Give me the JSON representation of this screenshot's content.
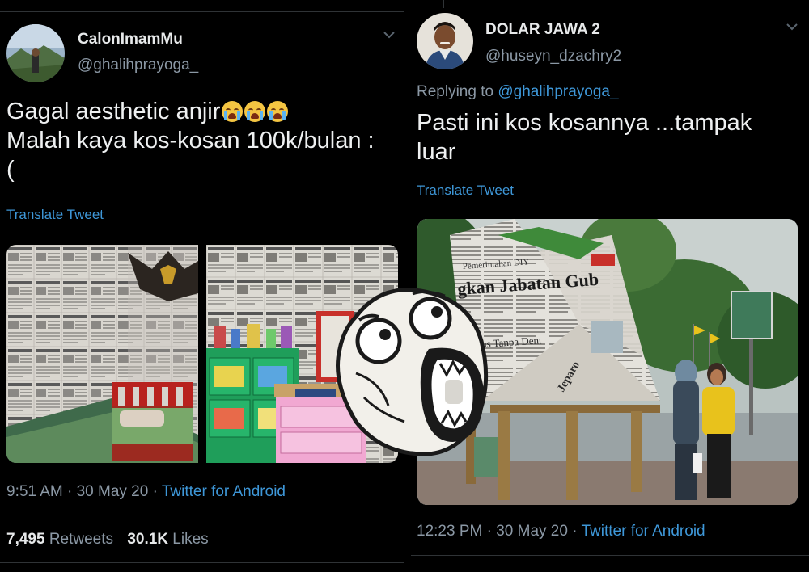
{
  "left_tweet": {
    "display_name": "CalonImamMu",
    "handle": "@ghalihprayoga_",
    "text_line1": "Gagal aesthetic anjir",
    "text_line2": "Malah kaya kos-kosan 100k/bulan :",
    "text_line3": "(",
    "emoji": [
      "loudly-crying-face",
      "loudly-crying-face",
      "loudly-crying-face"
    ],
    "translate": "Translate Tweet",
    "time": "9:51 AM · 30 May 20 · ",
    "source": "Twitter for Android",
    "retweets_count": "7,495",
    "retweets_label": "Retweets",
    "likes_count": "30.1K",
    "likes_label": "Likes"
  },
  "right_tweet": {
    "display_name": "DOLAR JAWA 2",
    "handle": "@huseyn_dzachry2",
    "replying_label": "Replying to ",
    "replying_to": "@ghalihprayoga_",
    "text_line1": "Pasti ini kos kosannya ...tampak",
    "text_line2": "luar",
    "translate": "Translate Tweet",
    "time": "12:23 PM · 30 May 20 · ",
    "source": "Twitter for Android"
  },
  "photo_text": {
    "headline": "gkan Jabatan Gub",
    "top": "Pemerintahan DIY",
    "line3": "eius Tanpa Dent",
    "corner": "Jeparo"
  },
  "colors": {
    "background": "#000000",
    "link": "#3e97d8",
    "secondary_text": "#8b98a5",
    "primary_text": "#e7e9ea"
  },
  "icons": [
    "chevron-down-icon",
    "avatar",
    "lol-rage-face"
  ]
}
